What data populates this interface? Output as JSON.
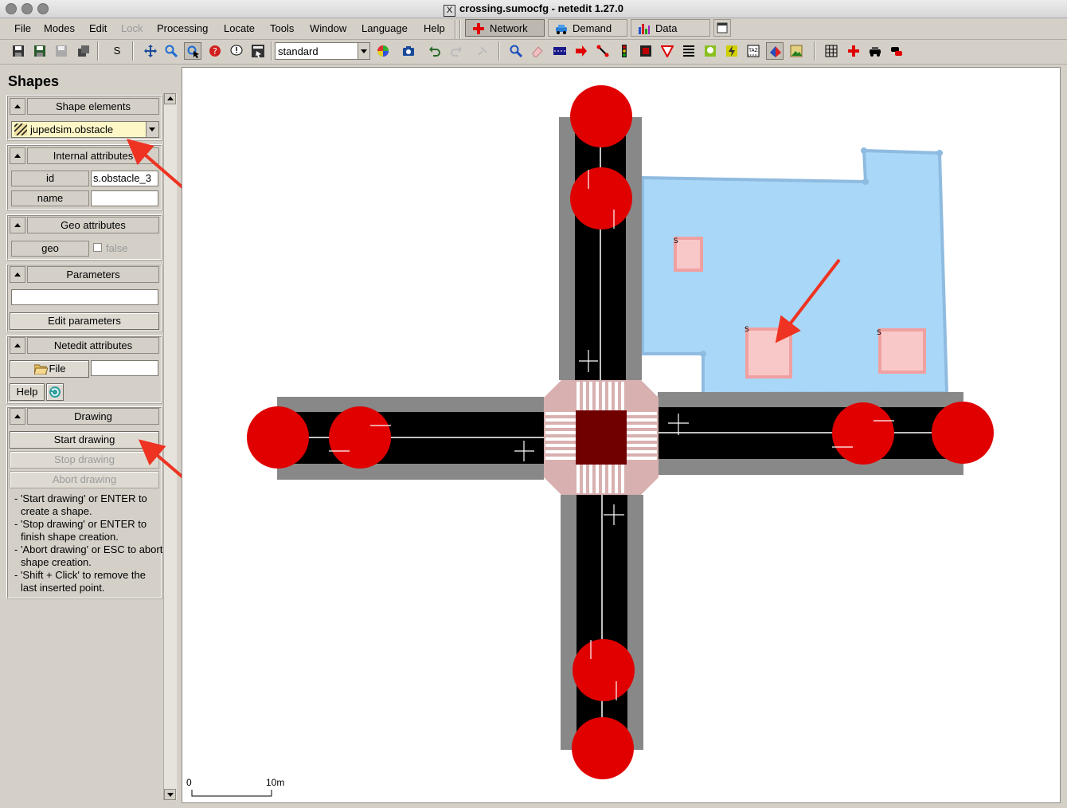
{
  "window": {
    "title": "crossing.sumocfg - netedit 1.27.0",
    "x_icon": "X"
  },
  "menubar": {
    "items": [
      "File",
      "Modes",
      "Edit",
      "Lock",
      "Processing",
      "Locate",
      "Tools",
      "Window",
      "Language",
      "Help"
    ]
  },
  "modes": {
    "network": "Network",
    "demand": "Demand",
    "data": "Data"
  },
  "toolbar": {
    "s_label": "S",
    "scheme": "standard"
  },
  "panel": {
    "title": "Shapes",
    "shape_elements": {
      "header": "Shape elements",
      "selected": "jupedsim.obstacle"
    },
    "internal": {
      "header": "Internal attributes",
      "id_label": "id",
      "id_value": "s.obstacle_3",
      "name_label": "name",
      "name_value": ""
    },
    "geo": {
      "header": "Geo attributes",
      "geo_label": "geo",
      "geo_value": "false"
    },
    "parameters": {
      "header": "Parameters",
      "value": "",
      "edit_button": "Edit parameters"
    },
    "netedit": {
      "header": "Netedit attributes",
      "file_button": "File",
      "file_value": "",
      "help_button": "Help"
    },
    "drawing": {
      "header": "Drawing",
      "start": "Start drawing",
      "stop": "Stop drawing",
      "abort": "Abort drawing",
      "help_lines": [
        "- 'Start drawing' or ENTER to create a shape.",
        "- 'Stop drawing' or ENTER to finish shape creation.",
        "- 'Abort drawing' or ESC to abort shape creation.",
        "- 'Shift + Click' to remove the last inserted point."
      ]
    }
  },
  "canvas": {
    "scale_start": "0",
    "scale_end": "10m",
    "obstacle_marker": "S"
  },
  "colors": {
    "junction": "#e00000",
    "polygon_fill": "#a9d7f7",
    "polygon_edge": "#8fbbe0",
    "obstacle_fill": "#f8c8c8",
    "obstacle_edge": "#f0a0a0",
    "arrow": "#ee3322"
  }
}
